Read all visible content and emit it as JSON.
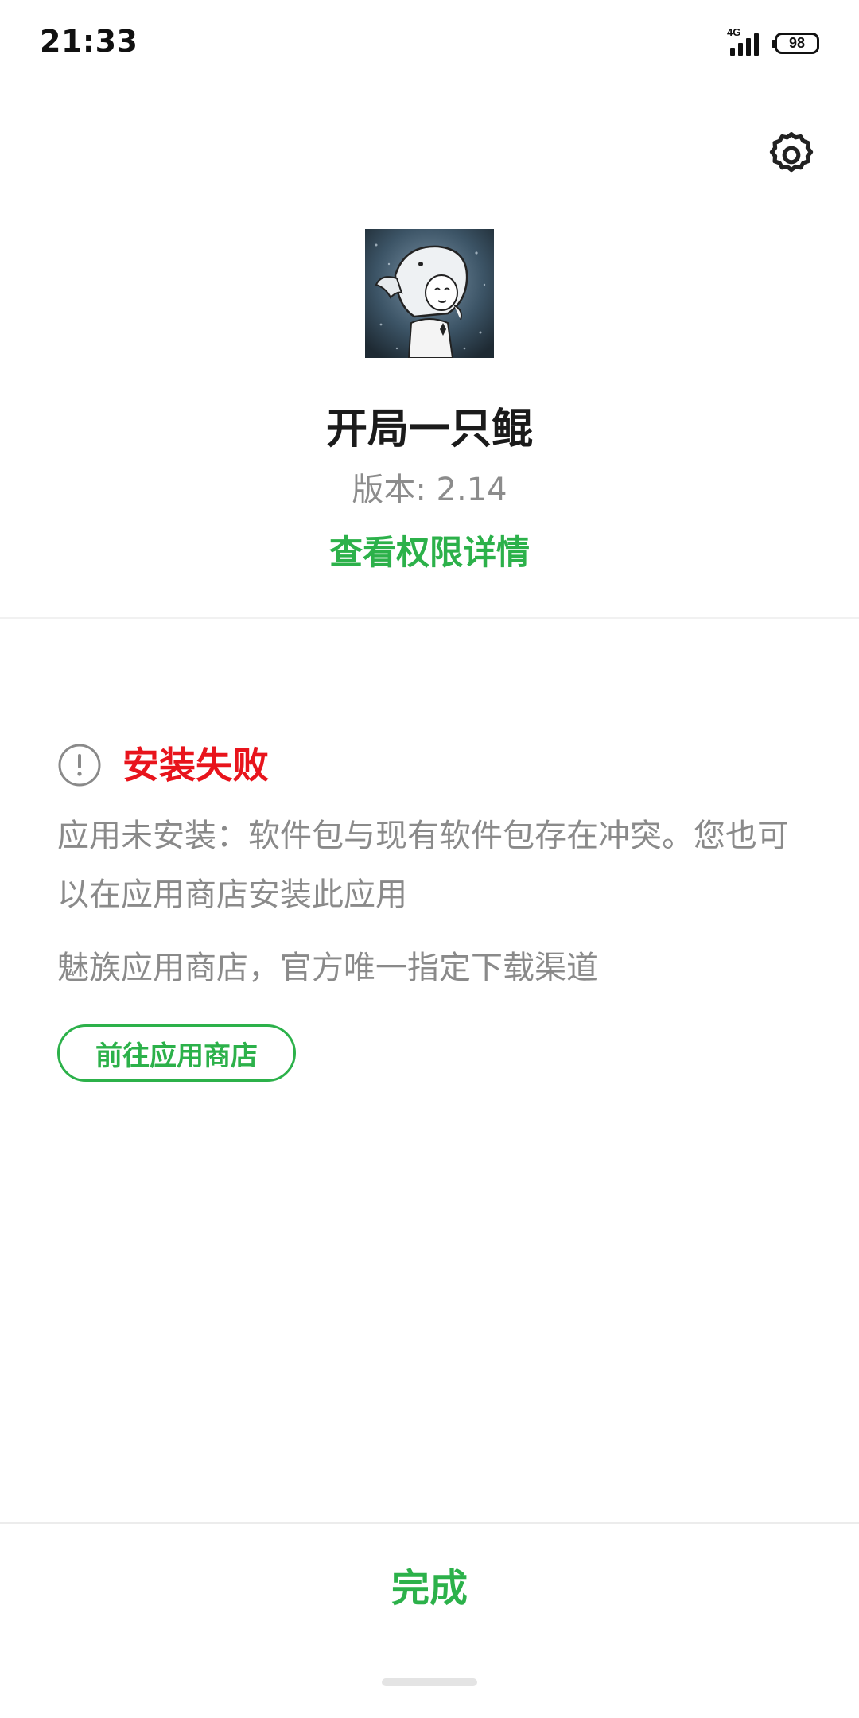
{
  "status_bar": {
    "time": "21:33",
    "network_type": "4G",
    "battery_level": "98",
    "icons": [
      "signal-icon",
      "battery-icon"
    ]
  },
  "header": {
    "settings_icon": "gear-icon"
  },
  "app": {
    "icon": "app-avatar-icon",
    "name": "开局一只鲲",
    "version": "版本: 2.14",
    "permission_link": "查看权限详情"
  },
  "result": {
    "status_icon": "alert-circle-icon",
    "title": "安装失败",
    "message": "应用未安装：软件包与现有软件包存在冲突。您也可以在应用商店安装此应用",
    "store_note": "魅族应用商店，官方唯一指定下载渠道",
    "store_button_label": "前往应用商店"
  },
  "footer": {
    "done_label": "完成"
  },
  "colors": {
    "accent": "#2cb14a",
    "error": "#e8141c",
    "secondary_text": "#8a8a8a",
    "primary_text": "#1b1b1b"
  }
}
